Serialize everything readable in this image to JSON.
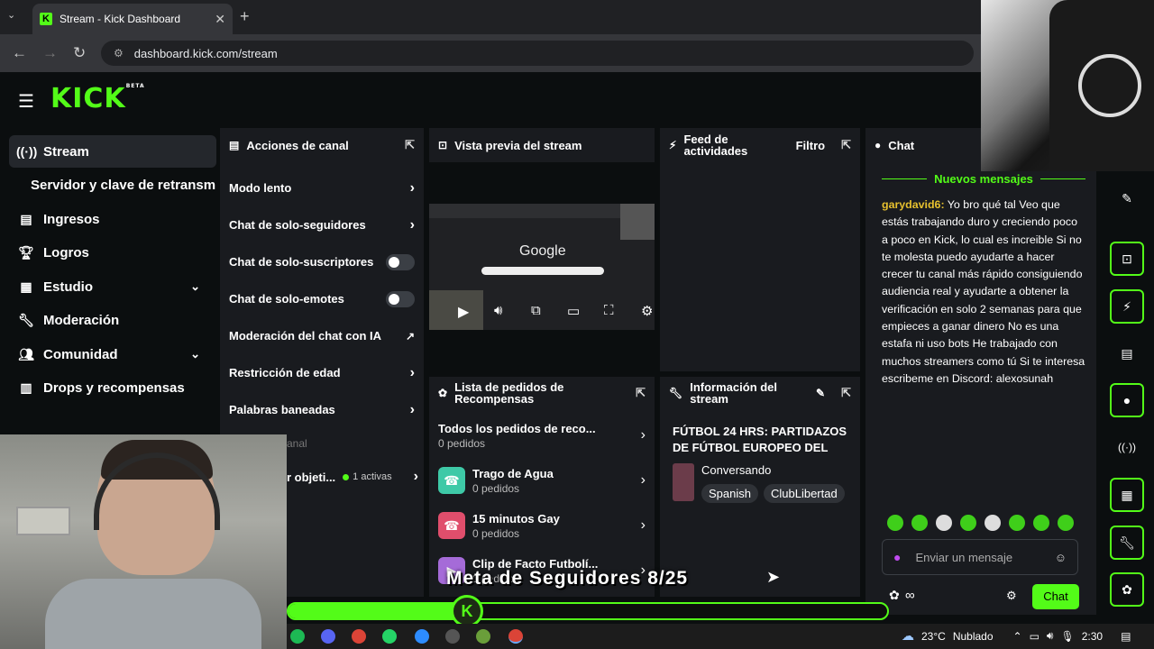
{
  "browser": {
    "tab_title": "Stream - Kick Dashboard",
    "tab_close": "✕",
    "new_tab": "+",
    "url": "dashboard.kick.com/stream"
  },
  "brand": {
    "logo": "KICK",
    "beta": "BETA",
    "accent": "#53fc18"
  },
  "sidebar": {
    "items": [
      {
        "label": "Stream",
        "icon": "broadcast-icon"
      },
      {
        "label": "Servidor y clave de retransmisión",
        "icon": ""
      },
      {
        "label": "Ingresos",
        "icon": "money-icon"
      },
      {
        "label": "Logros",
        "icon": "trophy-icon"
      },
      {
        "label": "Estudio",
        "icon": "studio-icon"
      },
      {
        "label": "Moderación",
        "icon": "wrench-icon"
      },
      {
        "label": "Comunidad",
        "icon": "community-icon"
      },
      {
        "label": "Drops y recompensas",
        "icon": "drops-icon"
      }
    ]
  },
  "channel_actions": {
    "title": "Acciones de canal",
    "rows": [
      {
        "label": "Modo lento"
      },
      {
        "label": "Chat de solo-seguidores"
      },
      {
        "label": "Chat de solo-suscriptores"
      },
      {
        "label": "Chat de solo-emotes"
      },
      {
        "label": "Moderación del chat con IA"
      },
      {
        "label": "Restricción de edad"
      },
      {
        "label": "Palabras baneadas"
      }
    ],
    "partial_section": "anal",
    "partial_row": "r objeti...",
    "active_count": "1 activas"
  },
  "preview": {
    "title": "Vista previa del stream",
    "search_brand": "Google"
  },
  "activity": {
    "title_line1": "Feed de",
    "title_line2": "actividades",
    "filter": "Filtro"
  },
  "rewards": {
    "title_line1": "Lista de pedidos de",
    "title_line2": "Recompensas",
    "items": [
      {
        "title": "Todos los pedidos de reco...",
        "sub": "0 pedidos",
        "color": ""
      },
      {
        "title": "Trago de Agua",
        "sub": "0 pedidos",
        "color": "#3ec9a7"
      },
      {
        "title": "15 minutos Gay",
        "sub": "0 pedidos",
        "color": "#e04e6c"
      },
      {
        "title": "Clip de Facto Futbolí...",
        "sub": "0 pedidos",
        "color": "#a56bd8"
      }
    ]
  },
  "stream_info": {
    "title_line1": "Información del",
    "title_line2": "stream",
    "stream_title": "FÚTBOL 24 HRS: PARTIDAZOS DE FÚTBOL EUROPEO DEL FI...",
    "category": "Conversando",
    "tags": [
      "Spanish",
      "ClubLibertad"
    ]
  },
  "chat": {
    "title": "Chat",
    "new_messages": "Nuevos mensajes",
    "message_user": "garydavid6",
    "message_text": "Yo bro qué tal Veo que estás trabajando duro y creciendo poco a poco en Kick, lo cual es increible Si no te molesta puedo ayudarte a hacer crecer tu canal más rápido consiguiendo audiencia real y ayudarte a obtener la verificación en solo 2 semanas para que empieces a ganar dinero No es una estafa ni uso bots He trabajado con muchos streamers como tú Si te interesa escribeme en Discord: alexosunah",
    "input_placeholder": "Enviar un mensaje",
    "send_label": "Chat",
    "infinity": "∞"
  },
  "overlay": {
    "goal_text": "Meta de Seguidores 8/25",
    "goal_progress": 0.32
  },
  "taskbar": {
    "temperature": "23°C",
    "weather": "Nublado",
    "time": "2:30"
  }
}
